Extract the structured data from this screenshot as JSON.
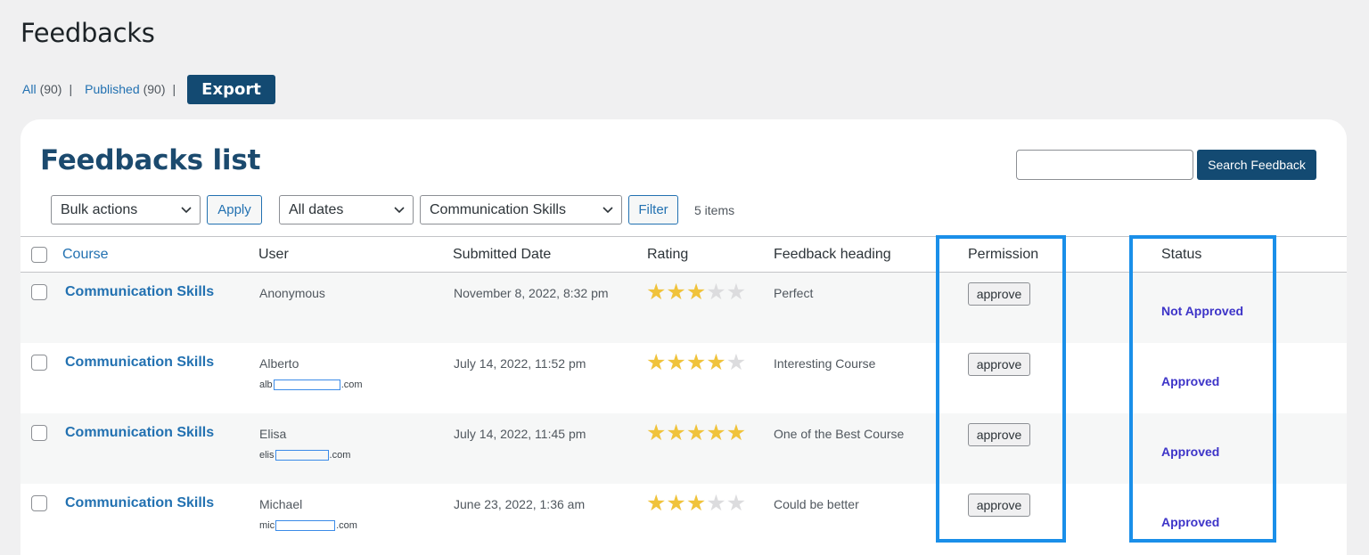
{
  "page": {
    "title": "Feedbacks"
  },
  "views": {
    "all_label": "All",
    "all_count": "(90)",
    "published_label": "Published",
    "published_count": "(90)",
    "separator": "|"
  },
  "toolbar": {
    "export_label": "Export"
  },
  "list": {
    "title": "Feedbacks list",
    "search_placeholder": "",
    "search_button": "Search Feedback",
    "bulk_actions": "Bulk actions",
    "apply_label": "Apply",
    "date_filter": "All dates",
    "course_filter": "Communication Skills",
    "filter_label": "Filter",
    "items_count": "5 items"
  },
  "columns": [
    "Course",
    "User",
    "Submitted Date",
    "Rating",
    "Feedback heading",
    "Permission",
    "Status"
  ],
  "rows": [
    {
      "course": "Communication Skills",
      "user": "Anonymous",
      "email_prefix": "",
      "email_suffix": "",
      "date": "November 8, 2022, 8:32 pm",
      "rating": 3,
      "heading": "Perfect",
      "permission": "approve",
      "status": "Not Approved"
    },
    {
      "course": "Communication Skills",
      "user": "Alberto",
      "email_prefix": "alb",
      "email_suffix": ".com",
      "date": "July 14, 2022, 11:52 pm",
      "rating": 4,
      "heading": "Interesting Course",
      "permission": "approve",
      "status": "Approved"
    },
    {
      "course": "Communication Skills",
      "user": "Elisa",
      "email_prefix": "elis",
      "email_suffix": ".com",
      "date": "July 14, 2022, 11:45 pm",
      "rating": 5,
      "heading": "One of the Best Course",
      "permission": "approve",
      "status": "Approved"
    },
    {
      "course": "Communication Skills",
      "user": "Michael",
      "email_prefix": "mic",
      "email_suffix": ".com",
      "date": "June 23, 2022, 1:36 am",
      "rating": 3,
      "heading": "Could be better",
      "permission": "approve",
      "status": "Approved"
    }
  ],
  "rating_max": 5,
  "colors": {
    "accent": "#2271b1",
    "brand_dark": "#134a72",
    "star": "#f0c33c",
    "status": "#3d34c8",
    "highlight": "#1a8fe9"
  }
}
